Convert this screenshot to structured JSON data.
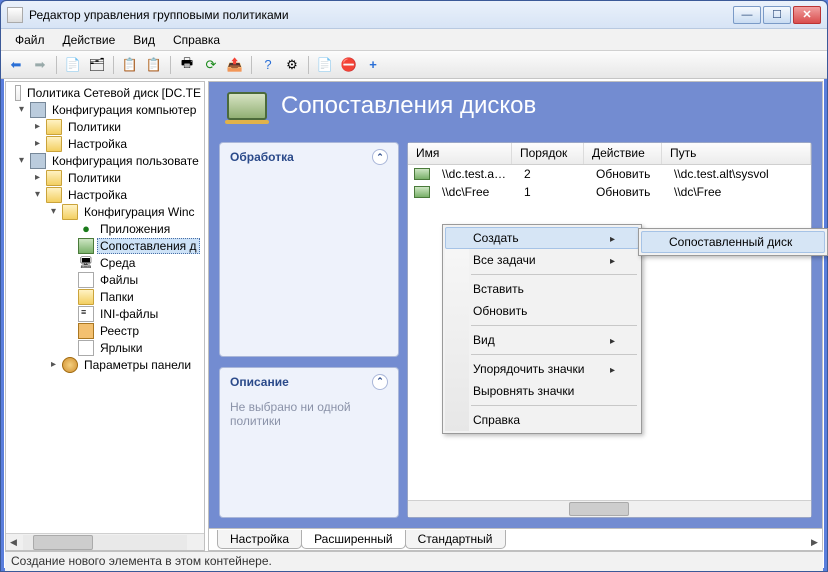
{
  "window": {
    "title": "Редактор управления групповыми политиками"
  },
  "menu": {
    "file": "Файл",
    "action": "Действие",
    "view": "Вид",
    "help": "Справка"
  },
  "tree": {
    "root": "Политика Сетевой диск [DC.TE",
    "comp_conf": "Конфигурация компьютер",
    "policies": "Политики",
    "settings": "Настройка",
    "user_conf": "Конфигурация пользовате",
    "win_conf": "Конфигурация Winc",
    "apps": "Приложения",
    "drive_maps": "Сопоставления д",
    "env": "Среда",
    "files": "Файлы",
    "folders": "Папки",
    "ini": "INI-файлы",
    "registry": "Реестр",
    "shortcuts": "Ярлыки",
    "ctrl_panel": "Параметры панели"
  },
  "header": {
    "title": "Сопоставления дисков"
  },
  "panels": {
    "processing": "Обработка",
    "description": "Описание",
    "desc_empty": "Не выбрано ни одной политики"
  },
  "list": {
    "cols": {
      "name": "Имя",
      "order": "Порядок",
      "action": "Действие",
      "path": "Путь"
    },
    "rows": [
      {
        "name": "\\\\dc.test.alt\\...",
        "order": "2",
        "action": "Обновить",
        "path": "\\\\dc.test.alt\\sysvol"
      },
      {
        "name": "\\\\dc\\Free",
        "order": "1",
        "action": "Обновить",
        "path": "\\\\dc\\Free"
      }
    ]
  },
  "tabs": {
    "settings": "Настройка",
    "extended": "Расширенный",
    "standard": "Стандартный"
  },
  "status": "Создание нового элемента в этом контейнере.",
  "ctx": {
    "create": "Создать",
    "all_tasks": "Все задачи",
    "paste": "Вставить",
    "refresh": "Обновить",
    "view": "Вид",
    "arrange": "Упорядочить значки",
    "align": "Выровнять значки",
    "help": "Справка",
    "mapped_drive": "Сопоставленный диск"
  }
}
